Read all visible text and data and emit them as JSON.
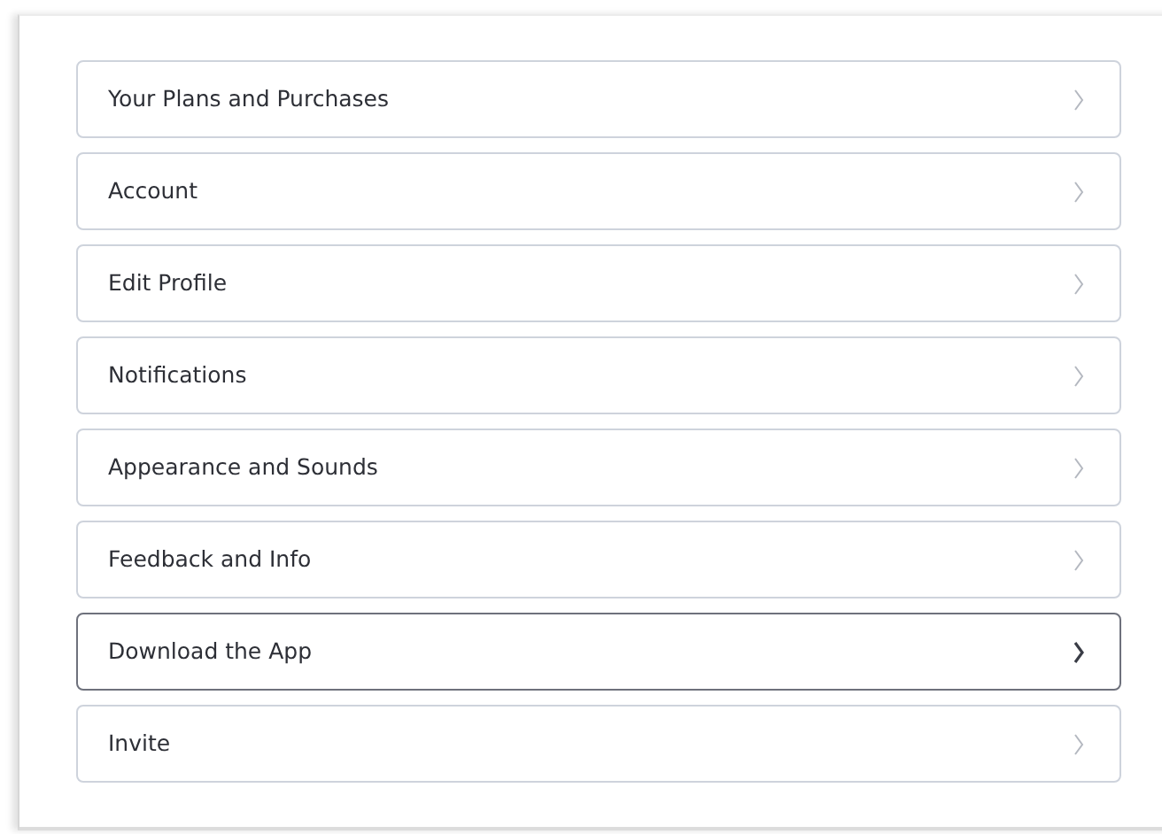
{
  "menu_items": [
    {
      "label": "Your Plans and Purchases",
      "highlighted": false
    },
    {
      "label": "Account",
      "highlighted": false
    },
    {
      "label": "Edit Profile",
      "highlighted": false
    },
    {
      "label": "Notifications",
      "highlighted": false
    },
    {
      "label": "Appearance and Sounds",
      "highlighted": false
    },
    {
      "label": "Feedback and Info",
      "highlighted": false
    },
    {
      "label": "Download the App",
      "highlighted": true
    },
    {
      "label": "Invite",
      "highlighted": false
    }
  ]
}
